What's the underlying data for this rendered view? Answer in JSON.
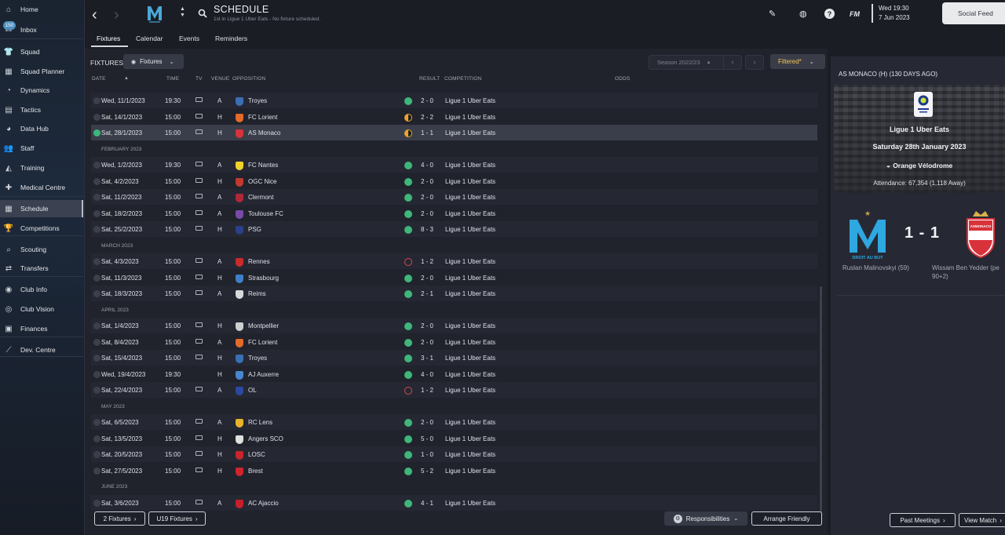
{
  "sidebar": {
    "items": [
      {
        "label": "Home",
        "icon": "home-icon",
        "glyph": "⌂"
      },
      {
        "label": "Inbox",
        "icon": "inbox-icon",
        "glyph": "✉",
        "badge": "150"
      },
      {
        "label": "Squad",
        "icon": "shirt-icon",
        "glyph": "👕"
      },
      {
        "label": "Squad Planner",
        "icon": "planner-icon",
        "glyph": "▦"
      },
      {
        "label": "Dynamics",
        "icon": "dynamics-icon",
        "glyph": "◔"
      },
      {
        "label": "Tactics",
        "icon": "tactics-icon",
        "glyph": "▤"
      },
      {
        "label": "Data Hub",
        "icon": "data-hub-icon",
        "glyph": "◕"
      },
      {
        "label": "Staff",
        "icon": "staff-icon",
        "glyph": "👥"
      },
      {
        "label": "Training",
        "icon": "training-icon",
        "glyph": "◭"
      },
      {
        "label": "Medical Centre",
        "icon": "medical-icon",
        "glyph": "✚"
      },
      {
        "label": "Schedule",
        "icon": "calendar-icon",
        "glyph": "▦"
      },
      {
        "label": "Competitions",
        "icon": "trophy-icon",
        "glyph": "🏆"
      },
      {
        "label": "Scouting",
        "icon": "scouting-icon",
        "glyph": "⌕"
      },
      {
        "label": "Transfers",
        "icon": "transfers-icon",
        "glyph": "⇄"
      },
      {
        "label": "Club Info",
        "icon": "club-info-icon",
        "glyph": "◉"
      },
      {
        "label": "Club Vision",
        "icon": "club-vision-icon",
        "glyph": "◎"
      },
      {
        "label": "Finances",
        "icon": "finances-icon",
        "glyph": "▣"
      },
      {
        "label": "Dev. Centre",
        "icon": "dev-centre-icon",
        "glyph": "⟋"
      }
    ]
  },
  "header": {
    "title": "SCHEDULE",
    "subtitle": "1st in Ligue 1 Uber Eats - No fixture scheduled.",
    "tabs": [
      "Fixtures",
      "Calendar",
      "Events",
      "Reminders"
    ],
    "date": "Wed 19:30",
    "date2": "7 Jun 2023",
    "fm_label": "FM",
    "social_feed": "Social Feed",
    "accent": "#4aa8d8"
  },
  "toolbar": {
    "fixtures_label": "FIXTURES",
    "fixtures_dropdown": "Fixtures",
    "season": "Season 2022/23",
    "filtered": "Filtered*"
  },
  "columns": [
    "DATE",
    "TIME",
    "TV",
    "VENUE",
    "OPPOSITION",
    "RESULT",
    "COMPETITION",
    "ODDS"
  ],
  "rows": [
    {
      "date": "Wed, 11/1/2023",
      "time": "19:30",
      "tv": true,
      "venue": "A",
      "team": "Troyes",
      "crest": "#3a6fb5",
      "result": "2 - 0",
      "outcome": "win",
      "comp": "Ligue 1 Uber Eats"
    },
    {
      "date": "Sat, 14/1/2023",
      "time": "15:00",
      "tv": true,
      "venue": "H",
      "team": "FC Lorient",
      "crest": "#e46a2a",
      "result": "2 - 2",
      "outcome": "draw",
      "comp": "Ligue 1 Uber Eats"
    },
    {
      "date": "Sat, 28/1/2023",
      "time": "15:00",
      "tv": true,
      "venue": "H",
      "team": "AS Monaco",
      "crest": "#d8323a",
      "result": "1 - 1",
      "outcome": "draw",
      "comp": "Ligue 1 Uber Eats",
      "selected": true
    },
    {
      "month": "FEBRUARY 2023"
    },
    {
      "date": "Wed, 1/2/2023",
      "time": "19:30",
      "tv": true,
      "venue": "A",
      "team": "FC Nantes",
      "crest": "#f2d22a",
      "result": "4 - 0",
      "outcome": "win",
      "comp": "Ligue 1 Uber Eats"
    },
    {
      "date": "Sat, 4/2/2023",
      "time": "15:00",
      "tv": true,
      "venue": "H",
      "team": "OGC Nice",
      "crest": "#c23a2f",
      "result": "2 - 0",
      "outcome": "win",
      "comp": "Ligue 1 Uber Eats"
    },
    {
      "date": "Sat, 11/2/2023",
      "time": "15:00",
      "tv": true,
      "venue": "A",
      "team": "Clermont",
      "crest": "#b3263a",
      "result": "2 - 0",
      "outcome": "win",
      "comp": "Ligue 1 Uber Eats"
    },
    {
      "date": "Sat, 18/2/2023",
      "time": "15:00",
      "tv": true,
      "venue": "A",
      "team": "Toulouse FC",
      "crest": "#7a4aa8",
      "result": "2 - 0",
      "outcome": "win",
      "comp": "Ligue 1 Uber Eats"
    },
    {
      "date": "Sat, 25/2/2023",
      "time": "15:00",
      "tv": true,
      "venue": "H",
      "team": "PSG",
      "crest": "#2b3f8a",
      "result": "8 - 3",
      "outcome": "win",
      "comp": "Ligue 1 Uber Eats"
    },
    {
      "month": "MARCH 2023"
    },
    {
      "date": "Sat, 4/3/2023",
      "time": "15:00",
      "tv": true,
      "venue": "A",
      "team": "Rennes",
      "crest": "#cc2a2a",
      "result": "1 - 2",
      "outcome": "loss",
      "comp": "Ligue 1 Uber Eats"
    },
    {
      "date": "Sat, 11/3/2023",
      "time": "15:00",
      "tv": true,
      "venue": "H",
      "team": "Strasbourg",
      "crest": "#3f7fc9",
      "result": "2 - 0",
      "outcome": "win",
      "comp": "Ligue 1 Uber Eats"
    },
    {
      "date": "Sat, 18/3/2023",
      "time": "15:00",
      "tv": true,
      "venue": "A",
      "team": "Reims",
      "crest": "#d9d9d9",
      "result": "2 - 1",
      "outcome": "win",
      "comp": "Ligue 1 Uber Eats"
    },
    {
      "month": "APRIL 2023"
    },
    {
      "date": "Sat, 1/4/2023",
      "time": "15:00",
      "tv": true,
      "venue": "H",
      "team": "Montpellier",
      "crest": "#cfcfcf",
      "result": "2 - 0",
      "outcome": "win",
      "comp": "Ligue 1 Uber Eats"
    },
    {
      "date": "Sat, 8/4/2023",
      "time": "15:00",
      "tv": true,
      "venue": "A",
      "team": "FC Lorient",
      "crest": "#e46a2a",
      "result": "2 - 0",
      "outcome": "win",
      "comp": "Ligue 1 Uber Eats"
    },
    {
      "date": "Sat, 15/4/2023",
      "time": "15:00",
      "tv": true,
      "venue": "H",
      "team": "Troyes",
      "crest": "#3a6fb5",
      "result": "3 - 1",
      "outcome": "win",
      "comp": "Ligue 1 Uber Eats"
    },
    {
      "date": "Wed, 19/4/2023",
      "time": "19:30",
      "tv": false,
      "venue": "H",
      "team": "AJ Auxerre",
      "crest": "#4a86d0",
      "result": "4 - 0",
      "outcome": "win",
      "comp": "Ligue 1 Uber Eats"
    },
    {
      "date": "Sat, 22/4/2023",
      "time": "15:00",
      "tv": true,
      "venue": "A",
      "team": "OL",
      "crest": "#2a4aa0",
      "result": "1 - 2",
      "outcome": "loss",
      "comp": "Ligue 1 Uber Eats"
    },
    {
      "month": "MAY 2023"
    },
    {
      "date": "Sat, 6/5/2023",
      "time": "15:00",
      "tv": true,
      "venue": "A",
      "team": "RC Lens",
      "crest": "#e9b22a",
      "result": "2 - 0",
      "outcome": "win",
      "comp": "Ligue 1 Uber Eats"
    },
    {
      "date": "Sat, 13/5/2023",
      "time": "15:00",
      "tv": true,
      "venue": "H",
      "team": "Angers SCO",
      "crest": "#e0e0e0",
      "result": "5 - 0",
      "outcome": "win",
      "comp": "Ligue 1 Uber Eats"
    },
    {
      "date": "Sat, 20/5/2023",
      "time": "15:00",
      "tv": true,
      "venue": "H",
      "team": "LOSC",
      "crest": "#c9252c",
      "result": "1 - 0",
      "outcome": "win",
      "comp": "Ligue 1 Uber Eats"
    },
    {
      "date": "Sat, 27/5/2023",
      "time": "15:00",
      "tv": true,
      "venue": "H",
      "team": "Brest",
      "crest": "#d0242b",
      "result": "5 - 2",
      "outcome": "win",
      "comp": "Ligue 1 Uber Eats"
    },
    {
      "month": "JUNE 2023"
    },
    {
      "date": "Sat, 3/6/2023",
      "time": "15:00",
      "tv": true,
      "venue": "A",
      "team": "AC Ajaccio",
      "crest": "#c8202a",
      "result": "4 - 1",
      "outcome": "win",
      "comp": "Ligue 1 Uber Eats"
    }
  ],
  "outcome_colors": {
    "win": "#3fb67a",
    "draw": "#e8a32a",
    "loss": "#d24a4a"
  },
  "footer": {
    "fixtures2": "2 Fixtures",
    "u19": "U19 Fixtures",
    "responsibilities": "Responsibilities",
    "arrange": "Arrange Friendly"
  },
  "match_panel": {
    "title": "AS MONACO (H) (130 DAYS AGO)",
    "competition": "Ligue 1 Uber Eats",
    "date": "Saturday 28th January 2023",
    "stadium": "Orange Vélodrome",
    "attendance": "Attendance: 67,354 (1,118 Away)",
    "score": "1 - 1",
    "home_scorer": "Ruslan Malinovskyi (59)",
    "away_scorer": "Wissam Ben Yedder (pe",
    "away_scorer2": "90+2)",
    "home_crest_text": "DROIT AU BUT",
    "away_crest_text": "ASMONACO",
    "past_meetings": "Past Meetings",
    "view_match": "View Match"
  }
}
